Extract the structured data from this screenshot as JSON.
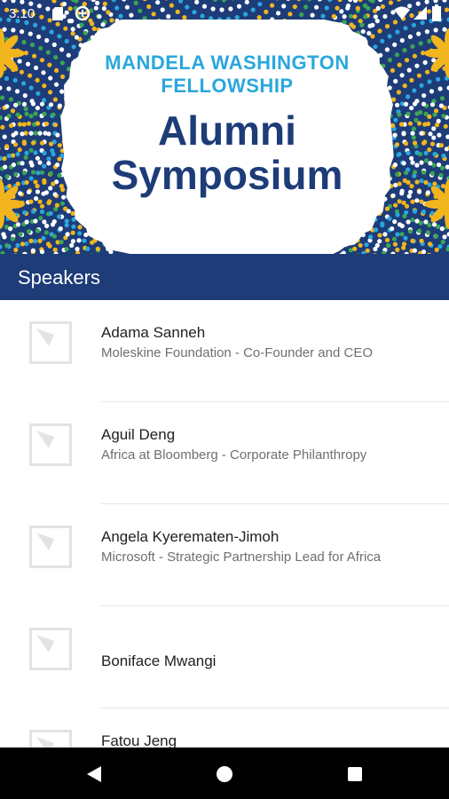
{
  "status_bar": {
    "time": "3:10"
  },
  "banner": {
    "fellowship": "MANDELA WASHINGTON FELLOWSHIP",
    "title_line1": "Alumni",
    "title_line2": "Symposium"
  },
  "toolbar": {
    "title": "Speakers"
  },
  "speakers": [
    {
      "name": "Adama Sanneh",
      "detail": "Moleskine Foundation - Co-Founder and CEO"
    },
    {
      "name": "Aguil Deng",
      "detail": "Africa at Bloomberg - Corporate Philanthropy"
    },
    {
      "name": "Angela Kyerematen-Jimoh",
      "detail": "Microsoft - Strategic Partnership Lead for Africa"
    },
    {
      "name": "Boniface Mwangi",
      "detail": ""
    },
    {
      "name": "Fatou Jeng",
      "detail": ""
    }
  ],
  "colors": {
    "primary": "#1d3c78",
    "accent": "#2aa7dc",
    "pattern_yellow": "#f2b51d",
    "pattern_green": "#3aa655"
  },
  "icons": {
    "thumbnail": "image-placeholder-icon",
    "nav_back": "back-triangle-icon",
    "nav_home": "home-circle-icon",
    "nav_recents": "recents-square-icon"
  }
}
